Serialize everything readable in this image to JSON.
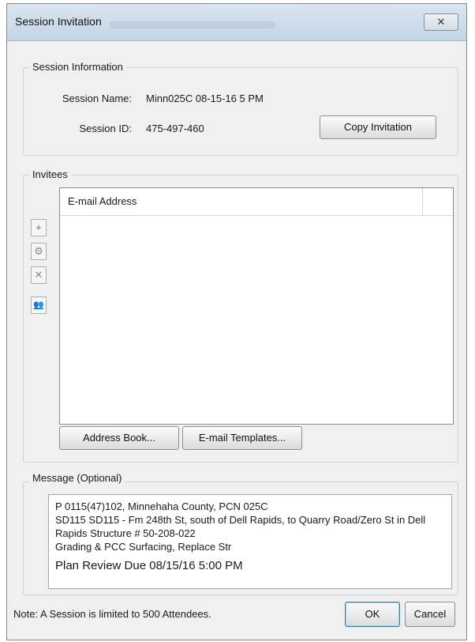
{
  "window": {
    "title": "Session Invitation",
    "close_label": "✕"
  },
  "session_info": {
    "group_label": "Session Information",
    "name_label": "Session Name:",
    "name_value": "Minn025C 08-15-16 5 PM",
    "id_label": "Session ID:",
    "id_value": "475-497-460",
    "copy_button": "Copy Invitation"
  },
  "invitees": {
    "group_label": "Invitees",
    "column_header": "E-mail Address",
    "side_buttons": [
      {
        "name": "add-icon",
        "glyph": "+",
        "color": "#3a9b3a"
      },
      {
        "name": "gear-icon",
        "glyph": "⚙",
        "color": "#8a8a8a"
      },
      {
        "name": "remove-icon",
        "glyph": "✕",
        "color": "#8a8a8a"
      },
      {
        "name": "people-icon",
        "glyph": "👥",
        "color": "#c08a1a"
      }
    ],
    "address_book_button": "Address Book...",
    "email_templates_button": "E-mail Templates..."
  },
  "message": {
    "group_label": "Message (Optional)",
    "lines": [
      "P 0115(47)102, Minnehaha County, PCN 025C",
      "SD115 SD115 - Fm 248th St, south of Dell Rapids, to Quarry Road/Zero St in Dell",
      "Rapids Structure # 50-208-022",
      "Grading & PCC Surfacing, Replace Str"
    ],
    "emphasis_line": "Plan Review Due 08/15/16 5:00 PM"
  },
  "footer": {
    "note": "Note: A Session is limited to 500 Attendees.",
    "ok_button": "OK",
    "cancel_button": "Cancel"
  }
}
